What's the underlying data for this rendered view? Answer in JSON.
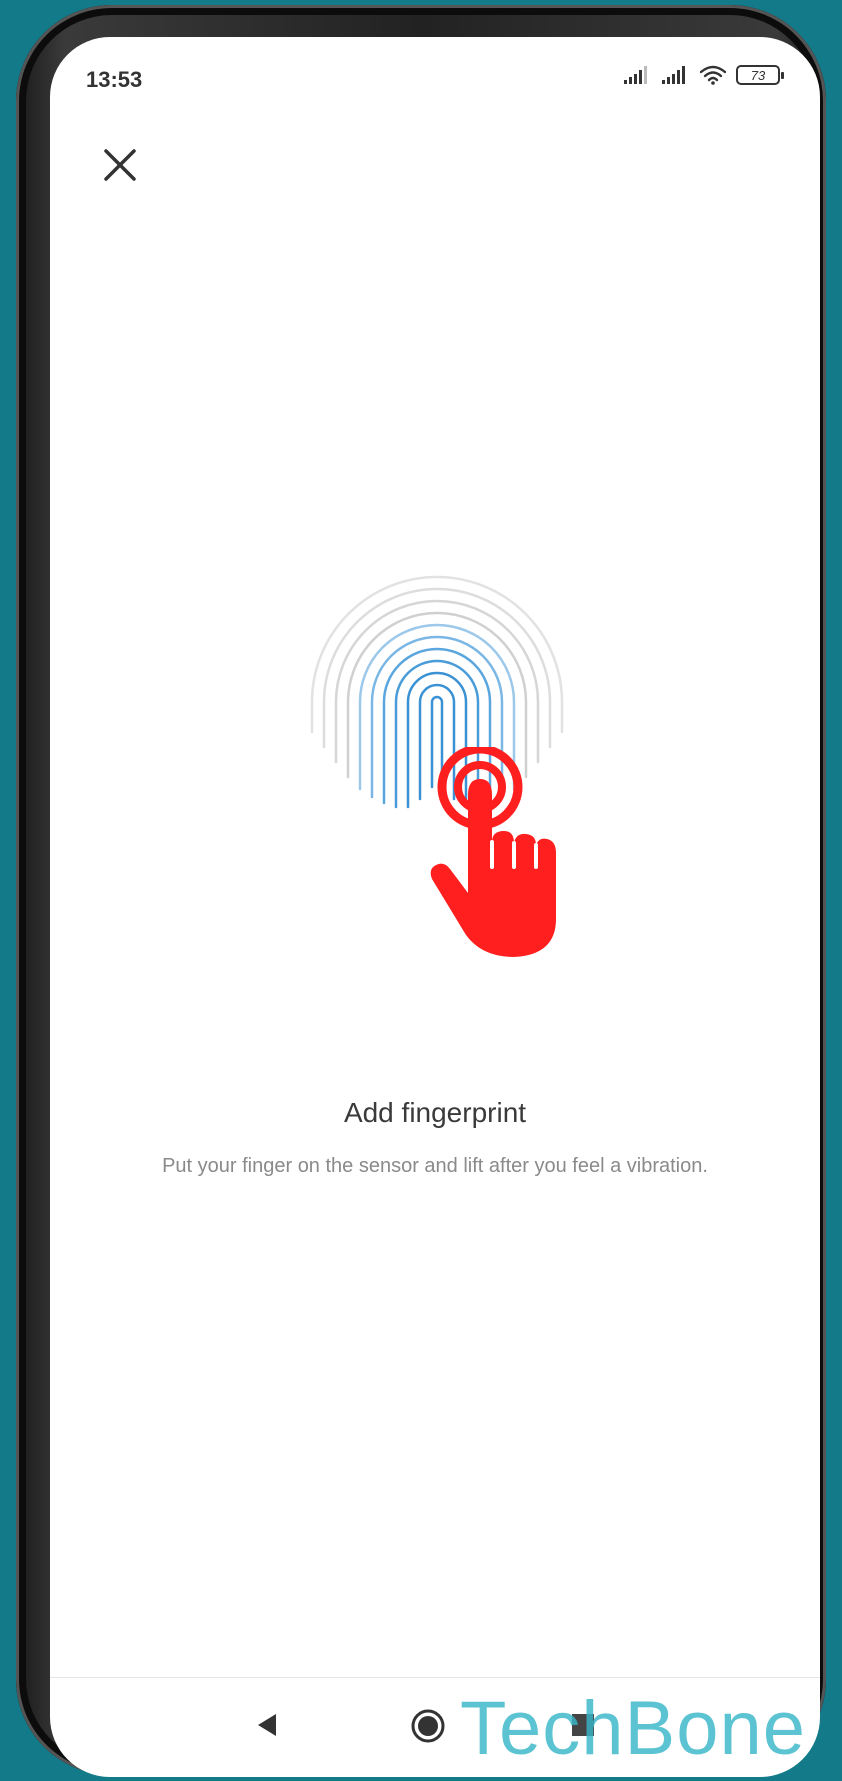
{
  "status_bar": {
    "time": "13:53",
    "battery": "73",
    "icons": [
      "signal-icon",
      "signal-icon",
      "wifi-icon",
      "battery-icon"
    ]
  },
  "header": {
    "close_icon": "close-icon"
  },
  "main": {
    "illustration": "fingerprint-icon",
    "overlay": "tap-hand-icon",
    "title": "Add fingerprint",
    "subtitle": "Put your finger on the sensor and lift after you feel a vibration."
  },
  "nav_bar": {
    "back_icon": "back-icon",
    "home_icon": "home-icon",
    "recents_icon": "recents-icon"
  },
  "watermark": {
    "text": "TechBone"
  },
  "colors": {
    "background": "#137a8a",
    "accent_blue": "#3a9ad9",
    "hand_red": "#ff1f1f",
    "watermark": "#38b6c9"
  }
}
